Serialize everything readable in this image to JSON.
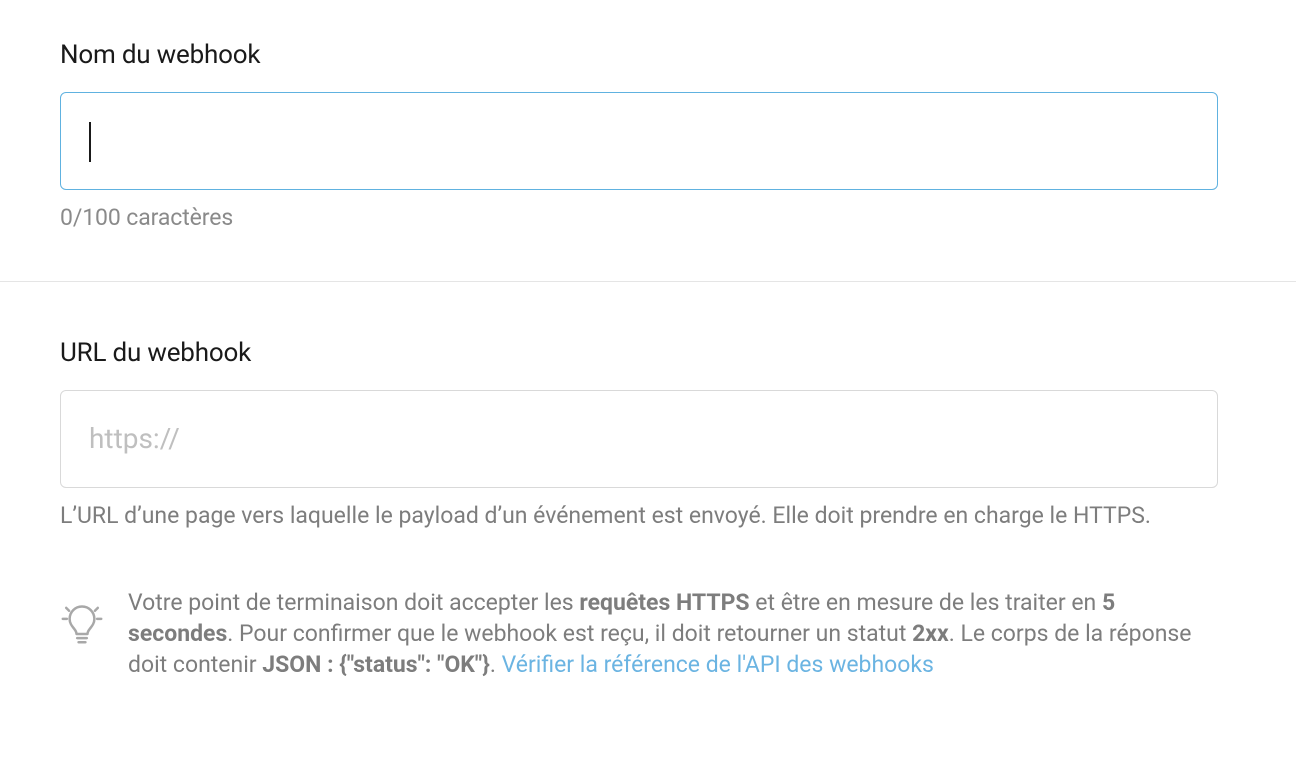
{
  "name_section": {
    "label": "Nom du webhook",
    "value": "",
    "helper": "0/100 caractères"
  },
  "url_section": {
    "label": "URL du webhook",
    "placeholder": "https://",
    "value": "",
    "description": "L’URL d’une page vers laquelle le payload d’un événement est envoyé. Elle doit prendre en charge le HTTPS."
  },
  "tip": {
    "pre1": "Votre point de terminaison doit accepter les ",
    "b1": "requêtes HTTPS",
    "mid1": " et être en mesure de les traiter en ",
    "b2": "5 secondes",
    "mid2": ". Pour confirmer que le webhook est reçu, il doit retourner un statut ",
    "b3": "2xx",
    "mid3": ". Le corps de la réponse doit contenir ",
    "b4": "JSON : {\"status\": \"OK\"}",
    "mid4": ". ",
    "link": "Vérifier la référence de l'API des webhooks"
  }
}
